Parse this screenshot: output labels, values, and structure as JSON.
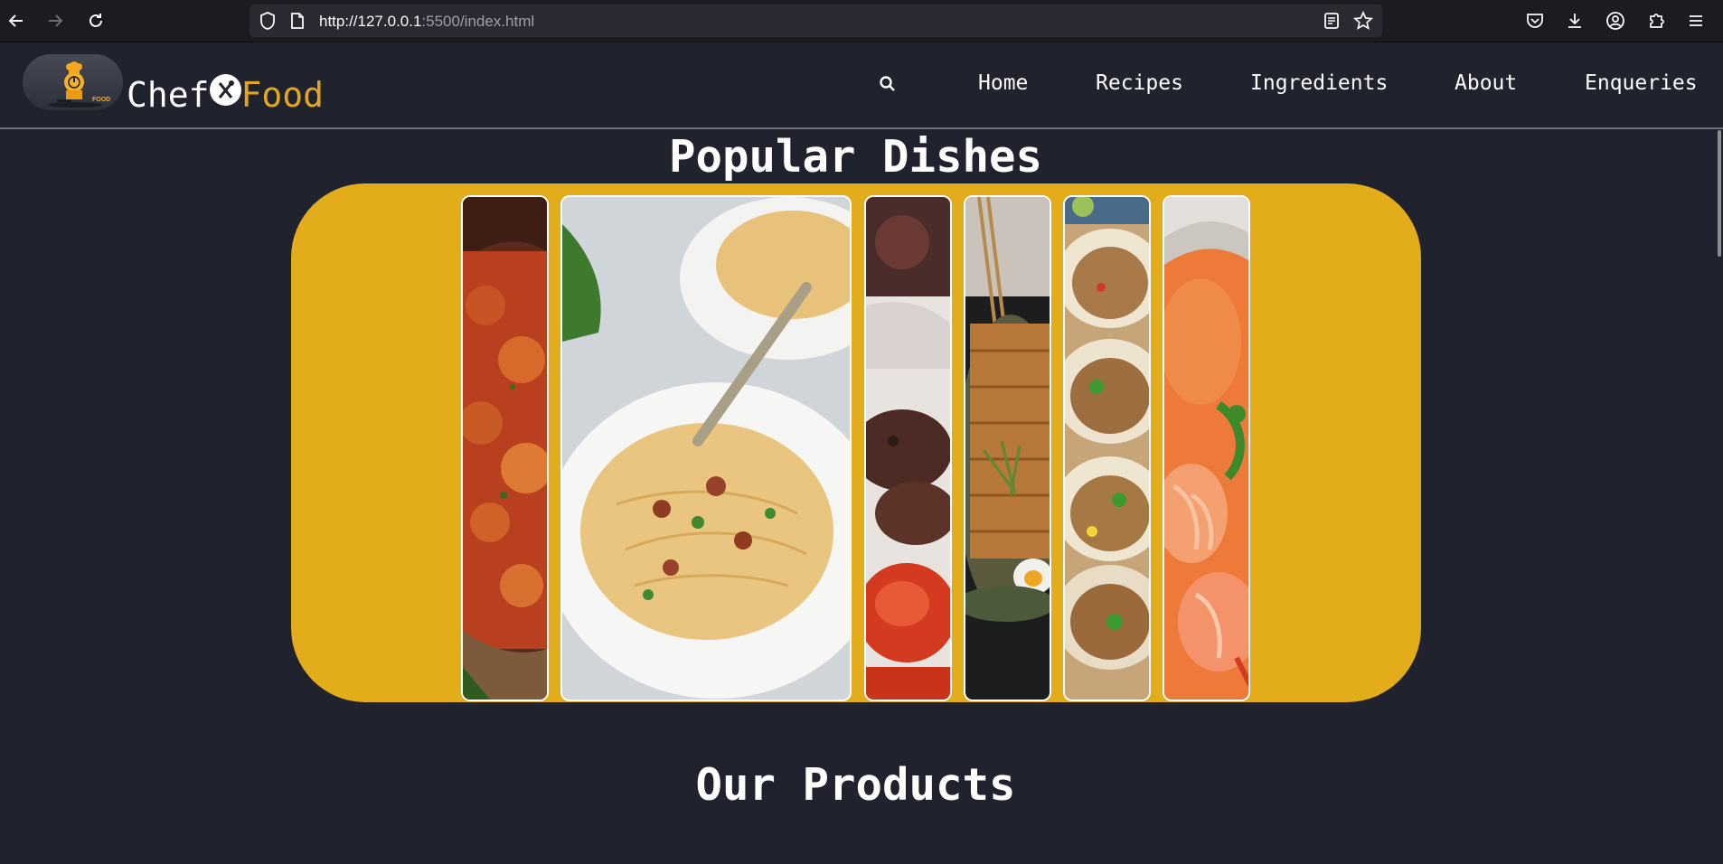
{
  "browser": {
    "url_host": "http://127.0.0.1",
    "url_rest": ":5500/index.html"
  },
  "brand": {
    "logo_text": "FOOD",
    "name_part1": "Chef",
    "name_part2": "Food",
    "accent_color": "#e3a71b"
  },
  "nav": {
    "items": [
      {
        "label": "Home"
      },
      {
        "label": "Recipes"
      },
      {
        "label": "Ingredients"
      },
      {
        "label": "About"
      },
      {
        "label": "Enqueries"
      }
    ]
  },
  "sections": {
    "popular_title": "Popular Dishes",
    "products_title": "Our Products"
  },
  "gallery": {
    "background_color": "#e3ac1b",
    "dishes": [
      {
        "name": "curry-dish-image"
      },
      {
        "name": "carbonara-pasta-image"
      },
      {
        "name": "grilled-meat-image"
      },
      {
        "name": "katsu-cutlet-image"
      },
      {
        "name": "tacos-image"
      },
      {
        "name": "shrimp-soup-image"
      }
    ]
  },
  "colors": {
    "page_background": "#20222e",
    "card_border": "#ffffff"
  }
}
